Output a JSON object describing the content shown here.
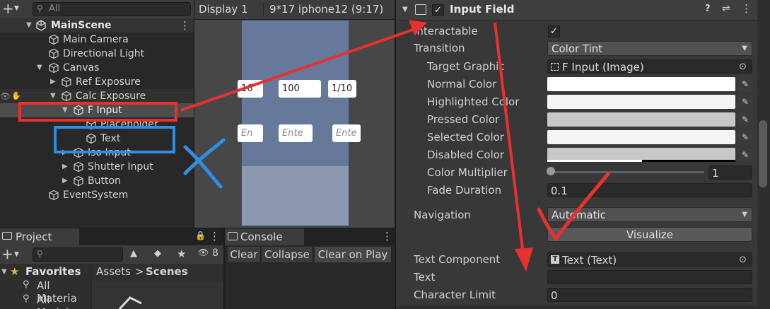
{
  "hierarchy": {
    "search_placeholder": "All",
    "rows": [
      {
        "label": "MainScene",
        "bold": true,
        "expanded": true
      },
      {
        "label": "Main Camera"
      },
      {
        "label": "Directional Light"
      },
      {
        "label": "Canvas",
        "expanded": true
      },
      {
        "label": "Ref Exposure",
        "collapsed": true
      },
      {
        "label": "Calc Exposure",
        "expanded": true
      },
      {
        "label": "F Input",
        "expanded": true
      },
      {
        "label": "Placeholder"
      },
      {
        "label": "Text"
      },
      {
        "label": "Iso Input",
        "collapsed": true
      },
      {
        "label": "Shutter Input",
        "collapsed": true
      },
      {
        "label": "Button",
        "collapsed": true
      },
      {
        "label": "EventSystem"
      }
    ],
    "more": "⋮"
  },
  "game": {
    "display": "Display 1",
    "resolution": "9*17 iphone12 (9:17)",
    "row1": [
      "16",
      "100",
      "1/10"
    ],
    "row2": [
      "En",
      "Ente",
      "Ente"
    ]
  },
  "project": {
    "tab": "Project",
    "layer_count": "8",
    "favorites": "Favorites",
    "fav_items": [
      "All Materia",
      "All Models"
    ],
    "breadcrumb": [
      "Assets",
      "Scenes"
    ],
    "sep": ">"
  },
  "console": {
    "tab": "Console",
    "buttons": [
      "Clear",
      "Collapse",
      "Clear on Play"
    ]
  },
  "inspector": {
    "component": "Input Field",
    "interactable": "Interactable",
    "transition": {
      "label": "Transition",
      "value": "Color Tint"
    },
    "target_graphic": {
      "label": "Target Graphic",
      "value": "F Input (Image)"
    },
    "colors": [
      {
        "label": "Normal Color",
        "color": "#ffffff"
      },
      {
        "label": "Highlighted Color",
        "color": "#f5f5f5"
      },
      {
        "label": "Pressed Color",
        "color": "#c8c8c8"
      },
      {
        "label": "Selected Color",
        "color": "#f5f5f5"
      },
      {
        "label": "Disabled Color",
        "color": "#c8c8c8"
      }
    ],
    "color_multiplier": {
      "label": "Color Multiplier",
      "value": "1",
      "fraction": 0
    },
    "fade_duration": {
      "label": "Fade Duration",
      "value": "0.1"
    },
    "navigation": {
      "label": "Navigation",
      "value": "Automatic"
    },
    "visualize": "Visualize",
    "text_component": {
      "label": "Text Component",
      "value": "Text (Text)"
    },
    "text": {
      "label": "Text",
      "value": ""
    },
    "character_limit": {
      "label": "Character Limit",
      "value": "0"
    }
  },
  "colors": {
    "accent_red": "#e8312f",
    "accent_blue": "#2f8ee3",
    "selection": "#4d4d4d"
  }
}
